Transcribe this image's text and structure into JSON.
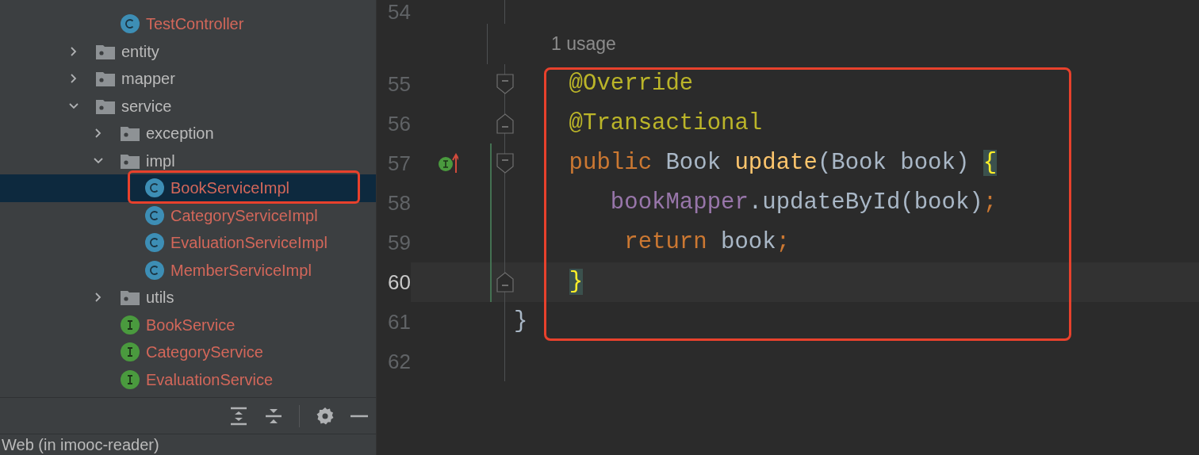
{
  "project_tree": {
    "leading_children": [
      {
        "label": "TestController",
        "kind": "class",
        "selected": false
      }
    ],
    "items": [
      {
        "label": "entity",
        "kind": "folder",
        "expanded": false,
        "selected": false
      },
      {
        "label": "mapper",
        "kind": "folder",
        "expanded": false,
        "selected": false
      },
      {
        "label": "service",
        "kind": "folder",
        "expanded": true,
        "selected": false,
        "children": [
          {
            "label": "exception",
            "kind": "folder",
            "expanded": false,
            "selected": false
          },
          {
            "label": "impl",
            "kind": "folder",
            "expanded": true,
            "selected": false,
            "children": [
              {
                "label": "BookServiceImpl",
                "kind": "class",
                "selected": true
              },
              {
                "label": "CategoryServiceImpl",
                "kind": "class",
                "selected": false
              },
              {
                "label": "EvaluationServiceImpl",
                "kind": "class",
                "selected": false
              },
              {
                "label": "MemberServiceImpl",
                "kind": "class",
                "selected": false
              }
            ]
          },
          {
            "label": "utils",
            "kind": "folder",
            "expanded": false,
            "selected": false
          },
          {
            "label": "BookService",
            "kind": "interface",
            "selected": false
          },
          {
            "label": "CategoryService",
            "kind": "interface",
            "selected": false
          },
          {
            "label": "EvaluationService",
            "kind": "interface",
            "selected": false
          }
        ]
      }
    ]
  },
  "bottom_panel": {
    "title": "Web (in imooc-reader)"
  },
  "editor": {
    "lines": [
      {
        "kind": "code",
        "number": "54",
        "current": false,
        "changed": false
      },
      {
        "kind": "inlay",
        "text": "1 usage"
      },
      {
        "kind": "code",
        "number": "55",
        "gutter_icons": [
          {
            "kind": "fold_start"
          }
        ],
        "current": false,
        "changed": false,
        "tokens": [
          {
            "text": "    @Override",
            "kind": "annotation"
          }
        ]
      },
      {
        "kind": "code",
        "number": "56",
        "gutter_icons": [
          {
            "kind": "fold_end"
          }
        ],
        "current": false,
        "changed": false,
        "tokens": [
          {
            "text": "    @Transactional",
            "kind": "annotation"
          }
        ]
      },
      {
        "kind": "code",
        "number": "57",
        "gutter_icons": [
          {
            "kind": "implementation"
          },
          {
            "kind": "fold_start"
          }
        ],
        "current": false,
        "changed": true,
        "tokens": [
          {
            "text": "    public ",
            "kind": "keyword"
          },
          {
            "text": "Book ",
            "kind": "plain"
          },
          {
            "text": "update",
            "kind": "method"
          },
          {
            "text": "(Book book) ",
            "kind": "plain"
          },
          {
            "text": "{",
            "kind": "brace_match"
          }
        ]
      },
      {
        "kind": "code",
        "number": "58",
        "current": false,
        "changed": true,
        "tokens": [
          {
            "text": "       bookMapper",
            "kind": "field"
          },
          {
            "text": ".updateById(book)",
            "kind": "plain"
          },
          {
            "text": ";",
            "kind": "keyword"
          }
        ]
      },
      {
        "kind": "code",
        "number": "59",
        "current": false,
        "changed": true,
        "tokens": [
          {
            "text": "        return ",
            "kind": "keyword"
          },
          {
            "text": "book",
            "kind": "plain"
          },
          {
            "text": ";",
            "kind": "keyword"
          }
        ]
      },
      {
        "kind": "code",
        "number": "60",
        "gutter_icons": [
          {
            "kind": "fold_end"
          }
        ],
        "current": true,
        "changed": true,
        "tokens": [
          {
            "text": "    }",
            "kind": "brace_match"
          }
        ]
      },
      {
        "kind": "code",
        "number": "61",
        "current": false,
        "changed": false,
        "tokens": [
          {
            "text": "}",
            "kind": "plain"
          }
        ]
      },
      {
        "kind": "code",
        "number": "62",
        "current": false,
        "changed": false
      }
    ]
  }
}
